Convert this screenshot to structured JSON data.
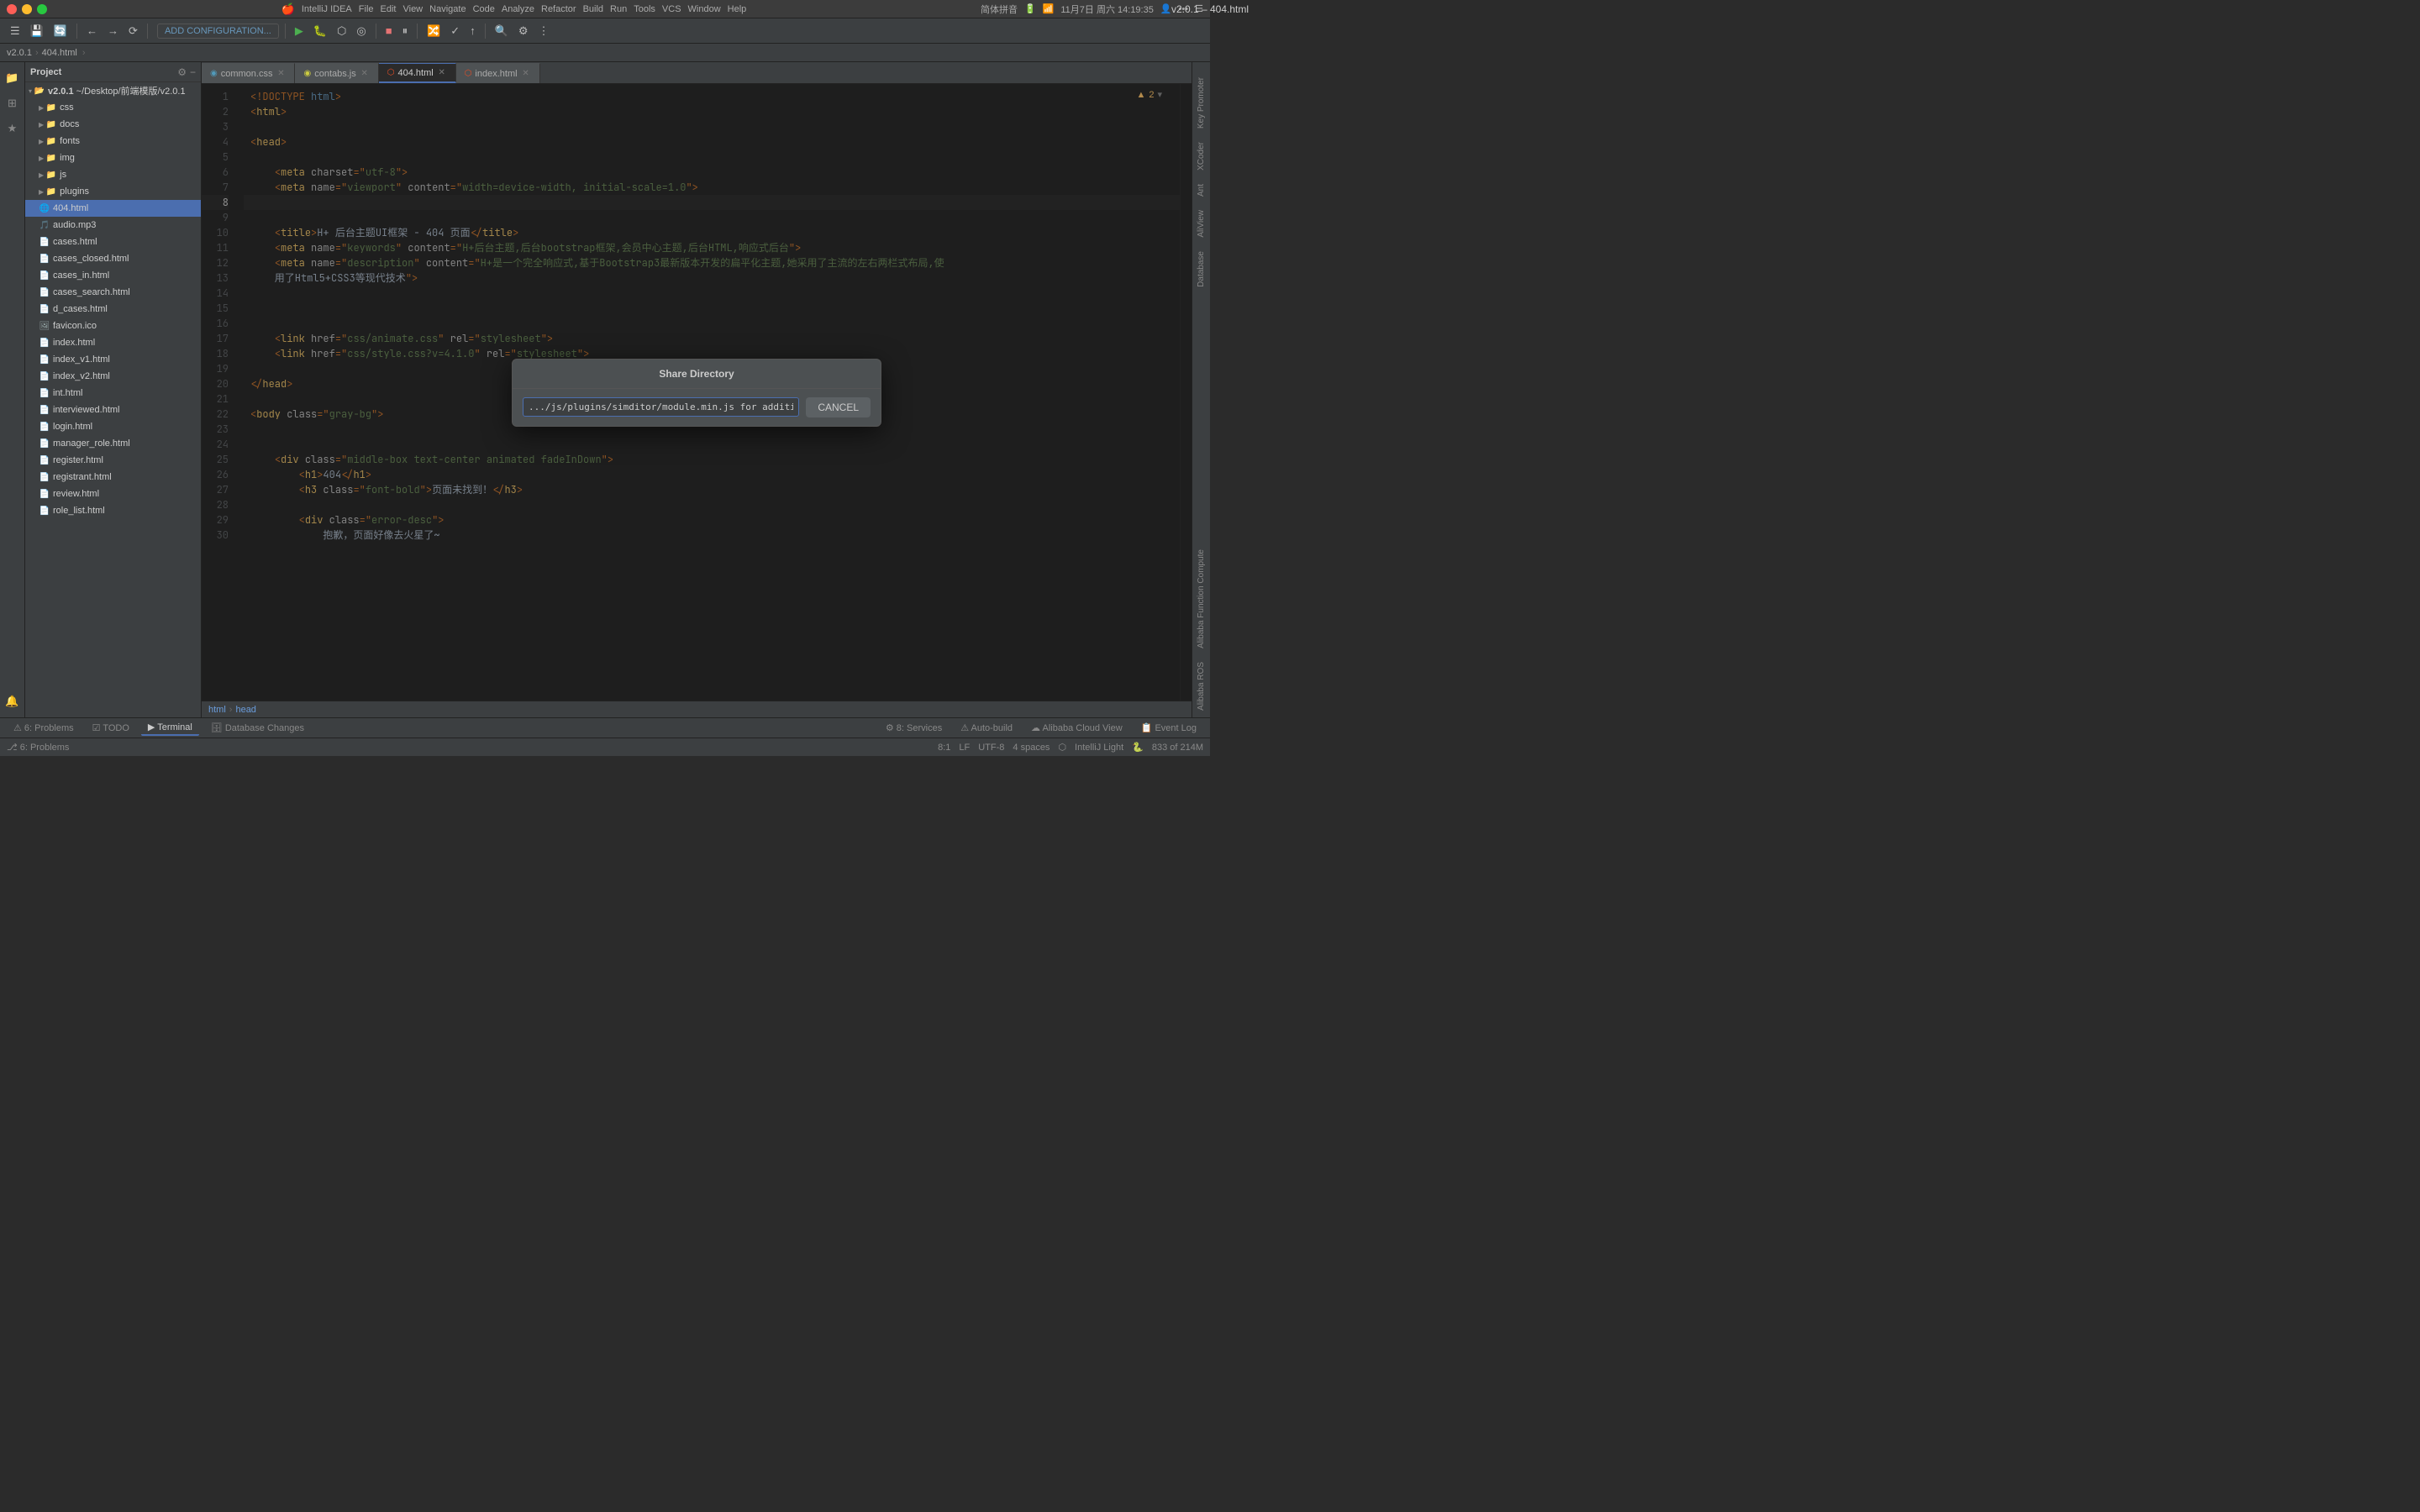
{
  "window": {
    "title": "v2.0.1 – 404.html",
    "app_name": "IntelliJ IDEA"
  },
  "titlebar": {
    "title": "v2.0.1 – 404.html",
    "time": "11月7日 周六 14:19:35",
    "battery": "🔋",
    "menu_items": [
      "IntelliJ IDEA",
      "File",
      "Edit",
      "View",
      "Navigate",
      "Code",
      "Analyze",
      "Refactor",
      "Build",
      "Run",
      "Tools",
      "VCS",
      "Window",
      "Help"
    ]
  },
  "toolbar": {
    "config_label": "ADD CONFIGURATION...",
    "breadcrumb": "v2.0.1",
    "breadcrumb_file": "404.html"
  },
  "project_panel": {
    "title": "Project",
    "root": "v2.0.1",
    "root_path": "~/Desktop/前端模版/v2.0.1",
    "folders": [
      "css",
      "docs",
      "fonts",
      "img",
      "js",
      "plugins"
    ],
    "files": [
      "404.html",
      "audio.mp3",
      "cases.html",
      "cases_closed.html",
      "cases_in.html",
      "cases_search.html",
      "d_cases.html",
      "favicon.ico",
      "index.html",
      "index_v1.html",
      "index_v2.html",
      "int.html",
      "interviewed.html",
      "login.html",
      "manager_role.html",
      "register.html",
      "registrant.html",
      "review.html",
      "role_list.html"
    ]
  },
  "tabs": [
    {
      "id": "common-css",
      "label": "common.css",
      "type": "css",
      "active": false
    },
    {
      "id": "contabs-js",
      "label": "contabs.js",
      "type": "js",
      "active": false
    },
    {
      "id": "404-html",
      "label": "404.html",
      "type": "html",
      "active": true
    },
    {
      "id": "index-html",
      "label": "index.html",
      "type": "html",
      "active": false
    }
  ],
  "code_lines": [
    {
      "num": 1,
      "content": "<!DOCTYPE html>",
      "active": false
    },
    {
      "num": 2,
      "content": "<html>",
      "active": false
    },
    {
      "num": 3,
      "content": "",
      "active": false
    },
    {
      "num": 4,
      "content": "<head>",
      "active": false
    },
    {
      "num": 5,
      "content": "",
      "active": false
    },
    {
      "num": 6,
      "content": "    <meta charset=\"utf-8\">",
      "active": false
    },
    {
      "num": 7,
      "content": "    <meta name=\"viewport\" content=\"width=device-width, initial-scale=1.0\">",
      "active": false
    },
    {
      "num": 8,
      "content": "",
      "active": true
    },
    {
      "num": 9,
      "content": "",
      "active": false
    },
    {
      "num": 10,
      "content": "    <title>H+ 后台主题UI框架 - 404 页面</title>",
      "active": false
    },
    {
      "num": 11,
      "content": "    <meta name=\"keywords\" content=\"H+后台主题,后台bootstrap框架,会员中心主题,后台HTML,响应式后台\">",
      "active": false
    },
    {
      "num": 12,
      "content": "    <meta name=\"description\" content=\"H+是一个完全响应式,基于Bootstrap3最新版本开发的扁平化主题,她采用了主流的左右两栏式布局,使",
      "active": false
    },
    {
      "num": 13,
      "content": "    用了Html5+CSS3等现代技术\">",
      "active": false
    },
    {
      "num": 14,
      "content": "",
      "active": false
    },
    {
      "num": 15,
      "content": "",
      "active": false
    },
    {
      "num": 16,
      "content": "",
      "active": false
    },
    {
      "num": 17,
      "content": "    <link href=\"css/animate.css\" rel=\"stylesheet\">",
      "active": false
    },
    {
      "num": 18,
      "content": "    <link href=\"css/style.css?v=4.1.0\" rel=\"stylesheet\">",
      "active": false
    },
    {
      "num": 19,
      "content": "",
      "active": false
    },
    {
      "num": 20,
      "content": "</head>",
      "active": false
    },
    {
      "num": 21,
      "content": "",
      "active": false
    },
    {
      "num": 22,
      "content": "<body class=\"gray-bg\">",
      "active": false
    },
    {
      "num": 23,
      "content": "",
      "active": false
    },
    {
      "num": 24,
      "content": "",
      "active": false
    },
    {
      "num": 25,
      "content": "    <div class=\"middle-box text-center animated fadeInDown\">",
      "active": false
    },
    {
      "num": 26,
      "content": "        <h1>404</h1>",
      "active": false
    },
    {
      "num": 27,
      "content": "        <h3 class=\"font-bold\">页面未找到！</h3>",
      "active": false
    },
    {
      "num": 28,
      "content": "",
      "active": false
    },
    {
      "num": 29,
      "content": "        <div class=\"error-desc\">",
      "active": false
    },
    {
      "num": 30,
      "content": "            抱歉，页面好像去火星了~",
      "active": false
    }
  ],
  "dialog": {
    "title": "Share Directory",
    "input_value": ".../js/plugins/simditor/module.min.js for addition",
    "cancel_label": "CANCEL"
  },
  "status_bar": {
    "left": [
      {
        "id": "problems",
        "icon": "⚠",
        "label": "6: Problems"
      },
      {
        "id": "todo",
        "icon": "☑",
        "label": "TODO"
      },
      {
        "id": "terminal",
        "icon": "▶",
        "label": "Terminal"
      },
      {
        "id": "db-changes",
        "icon": "🗄",
        "label": "Database Changes"
      }
    ],
    "right": [
      {
        "id": "services",
        "label": "8: Services"
      },
      {
        "id": "auto-build",
        "icon": "⚠",
        "label": "Auto-build"
      },
      {
        "id": "alibaba",
        "label": "Alibaba Cloud View"
      },
      {
        "id": "event-log",
        "label": "Event Log"
      }
    ],
    "cursor": "8:1",
    "line_ending": "LF",
    "encoding": "UTF-8",
    "indent": "4 spaces",
    "theme": "IntelliJ Light",
    "total_lines": "833 of 214M"
  },
  "right_sidebar_labels": [
    "Key Promoter",
    "XCoder",
    "Ant",
    "AliView",
    "Database",
    "Alibaba Function Compute",
    "Alibaba ROS"
  ],
  "warning_count": "▲ 2"
}
